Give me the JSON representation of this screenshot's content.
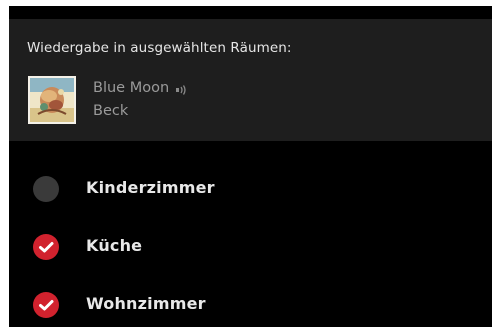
{
  "header": {
    "title": "Wiedergabe in ausgewählten Räumen:"
  },
  "now_playing": {
    "track": "Blue Moon",
    "artist": "Beck",
    "speaker_icon": "speaker-sound-icon",
    "album_art_icon": "album-cover"
  },
  "rooms": [
    {
      "label": "Kinderzimmer",
      "selected": false
    },
    {
      "label": "Küche",
      "selected": true
    },
    {
      "label": "Wohnzimmer",
      "selected": true
    }
  ],
  "colors": {
    "background": "#000000",
    "header_panel": "#1e1e1e",
    "accent_selected": "#d1222e",
    "unselected": "#3a3a3a",
    "primary_text": "#e8e8e8",
    "secondary_text": "#9a9a9a"
  }
}
